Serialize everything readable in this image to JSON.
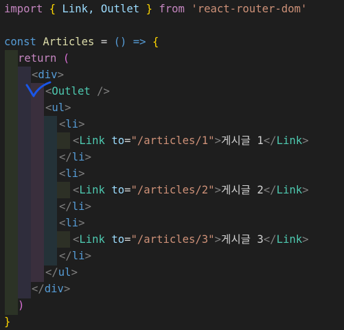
{
  "code": {
    "import_kw": "import",
    "import_names": "Link, Outlet",
    "from_kw": "from",
    "module": "'react-router-dom'",
    "const_kw": "const",
    "component_name": "Articles",
    "arrow": "() =>",
    "return_kw": "return",
    "div_tag": "div",
    "outlet_tag": "Outlet",
    "ul_tag": "ul",
    "li_tag": "li",
    "link_tag": "Link",
    "to_attr": "to",
    "links": [
      {
        "to": "\"/articles/1\"",
        "text": "게시글 1"
      },
      {
        "to": "\"/articles/2\"",
        "text": "게시글 2"
      },
      {
        "to": "\"/articles/3\"",
        "text": "게시글 3"
      }
    ]
  },
  "colors": {
    "background": "#1e1e1e",
    "keyword": "#c586c0",
    "tag": "#569cd6",
    "component": "#4ec9b0",
    "attribute": "#9cdcfe",
    "string": "#ce9178",
    "bracket_gold": "#ffd700",
    "bracket_purple": "#da70d6",
    "annotation_mark": "#1a56e8"
  }
}
